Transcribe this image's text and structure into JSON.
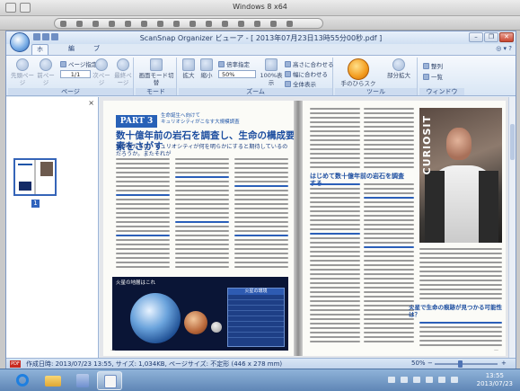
{
  "vm_window": {
    "title": "Windows 8 x64"
  },
  "app": {
    "title": "ScanSnap Organizer ビューア - [ 2013年07月23日13時55分00秒.pdf ]",
    "tabs": [
      {
        "label": "ホーム",
        "active": true
      },
      {
        "label": "編集",
        "active": false
      },
      {
        "label": "ブック補正",
        "active": false
      }
    ],
    "window_controls": {
      "minimize": "–",
      "restore": "❐",
      "close": "✕"
    },
    "help_icons": "◎ ▾ ?"
  },
  "ribbon": {
    "page_group": {
      "label": "ページ",
      "first_page": "先頭ページ",
      "prev_page": "前ページ",
      "page_specify": "ページ指定",
      "page_value": "1/1",
      "next_page": "次ページ",
      "last_page": "最終ページ"
    },
    "mode_group": {
      "label": "モード",
      "switch": "画面モード切替"
    },
    "zoom_group": {
      "label": "ズーム",
      "zoom_in": "拡大",
      "zoom_out": "縮小",
      "zoom_specify": "倍率指定",
      "zoom_value": "50%",
      "actual_size": "100%表示",
      "fit_height": "高さに合わせる",
      "fit_width": "幅に合わせる",
      "fit_all": "全体表示"
    },
    "tool_group": {
      "label": "ツール",
      "manual_scroll": "手のひらスクロール",
      "partial_zoom": "部分拡大"
    },
    "window_group": {
      "label": "ウィンドウ",
      "arrange": "整列",
      "list": "一覧"
    }
  },
  "thumbnails": {
    "close_label": "×",
    "pages": [
      {
        "number": "1"
      }
    ]
  },
  "document": {
    "part_label": "PART 3",
    "kicker": "生命誕生へ向けて\nキュリオシティがこなす大規模調査",
    "headline": "数十億年前の岩石を調査し、生命の構成要素をさがす",
    "subhead": "科学者たちは、キュリオシティが何を明らかにすると期待しているのだろうか。またそれが",
    "figure_caption": "火星の地層はこれ",
    "table_header": "火星の環境",
    "right_photo_label": "CURIOSIT",
    "right_heading": "はじめて数十億年前の岩石を調査する",
    "right_heading2": "火星で生命の痕跡が見つかる可能性は？"
  },
  "status_bar": {
    "info": "作成日時: 2013/07/23 13:55, サイズ: 1,034KB, ページサイズ: 不定形 (446 x 278 mm)",
    "zoom": "50%",
    "minus": "−",
    "plus": "+"
  },
  "taskbar": {
    "time": "13:55",
    "date": "2013/07/23"
  }
}
